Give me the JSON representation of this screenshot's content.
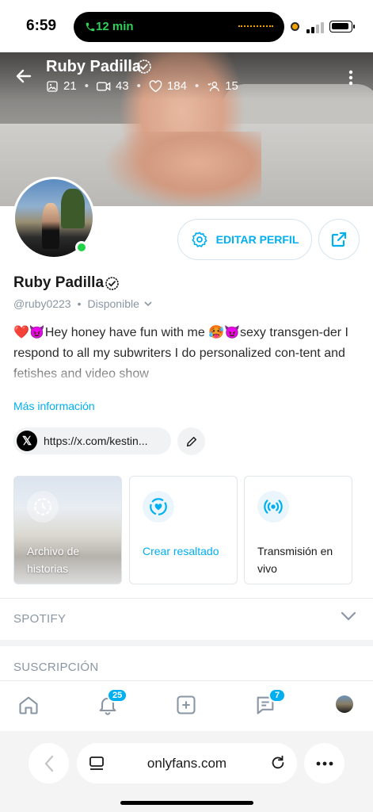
{
  "status_bar": {
    "time": "6:59",
    "call_time": "12 min"
  },
  "cover": {
    "name": "Ruby Padilla",
    "stats": {
      "photos": "21",
      "videos": "43",
      "likes": "184",
      "fans": "15"
    }
  },
  "profile": {
    "name": "Ruby Padilla",
    "handle": "@ruby0223",
    "availability": "Disponible",
    "edit_label": "EDITAR PERFIL",
    "bio": "❤️😈Hey honey have fun with me 🥵😈sexy transgen-der I respond to all my subwriters I do personalized con-tent and fetishes and video show",
    "more_label": "Más información",
    "link": "https://x.com/kestin..."
  },
  "cards": [
    {
      "label": "Archivo de historias"
    },
    {
      "label": "Crear resaltado"
    },
    {
      "label": "Transmisión en vivo"
    }
  ],
  "sections": {
    "spotify": "SPOTIFY",
    "subscription": "SUSCRIPCIÓN"
  },
  "nav": {
    "notifications_count": "25",
    "messages_count": "7"
  },
  "browser": {
    "url": "onlyfans.com"
  },
  "colors": {
    "accent": "#00aff0",
    "online": "#1fd246",
    "call": "#30d158"
  }
}
